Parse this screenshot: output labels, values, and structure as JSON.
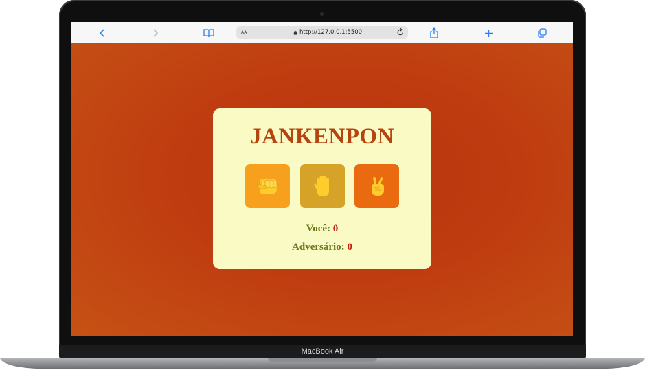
{
  "device": {
    "label": "MacBook Air"
  },
  "browser": {
    "url": "http://127.0.0.1:5500",
    "reader_label": "AA",
    "icons": [
      "back-icon",
      "forward-icon",
      "bookmarks-icon",
      "text-size-icon",
      "lock-icon",
      "reload-icon",
      "share-icon",
      "new-tab-icon",
      "tabs-icon"
    ]
  },
  "game": {
    "title": "JANKENPON",
    "choices": [
      {
        "name": "rock",
        "icon": "fist-icon",
        "color": "#f7a01d"
      },
      {
        "name": "paper",
        "icon": "hand-icon",
        "color": "#d6a227"
      },
      {
        "name": "scissors",
        "icon": "victory-hand-icon",
        "color": "#ea6a10"
      }
    ],
    "player_label": "Você:",
    "player_score": "0",
    "opponent_label": "Adversário:",
    "opponent_score": "0"
  },
  "colors": {
    "background": "#bf3c10",
    "card": "#fafac5",
    "title": "#b5450e",
    "score_label": "#6b7a1c",
    "score_value": "#c0230e"
  }
}
